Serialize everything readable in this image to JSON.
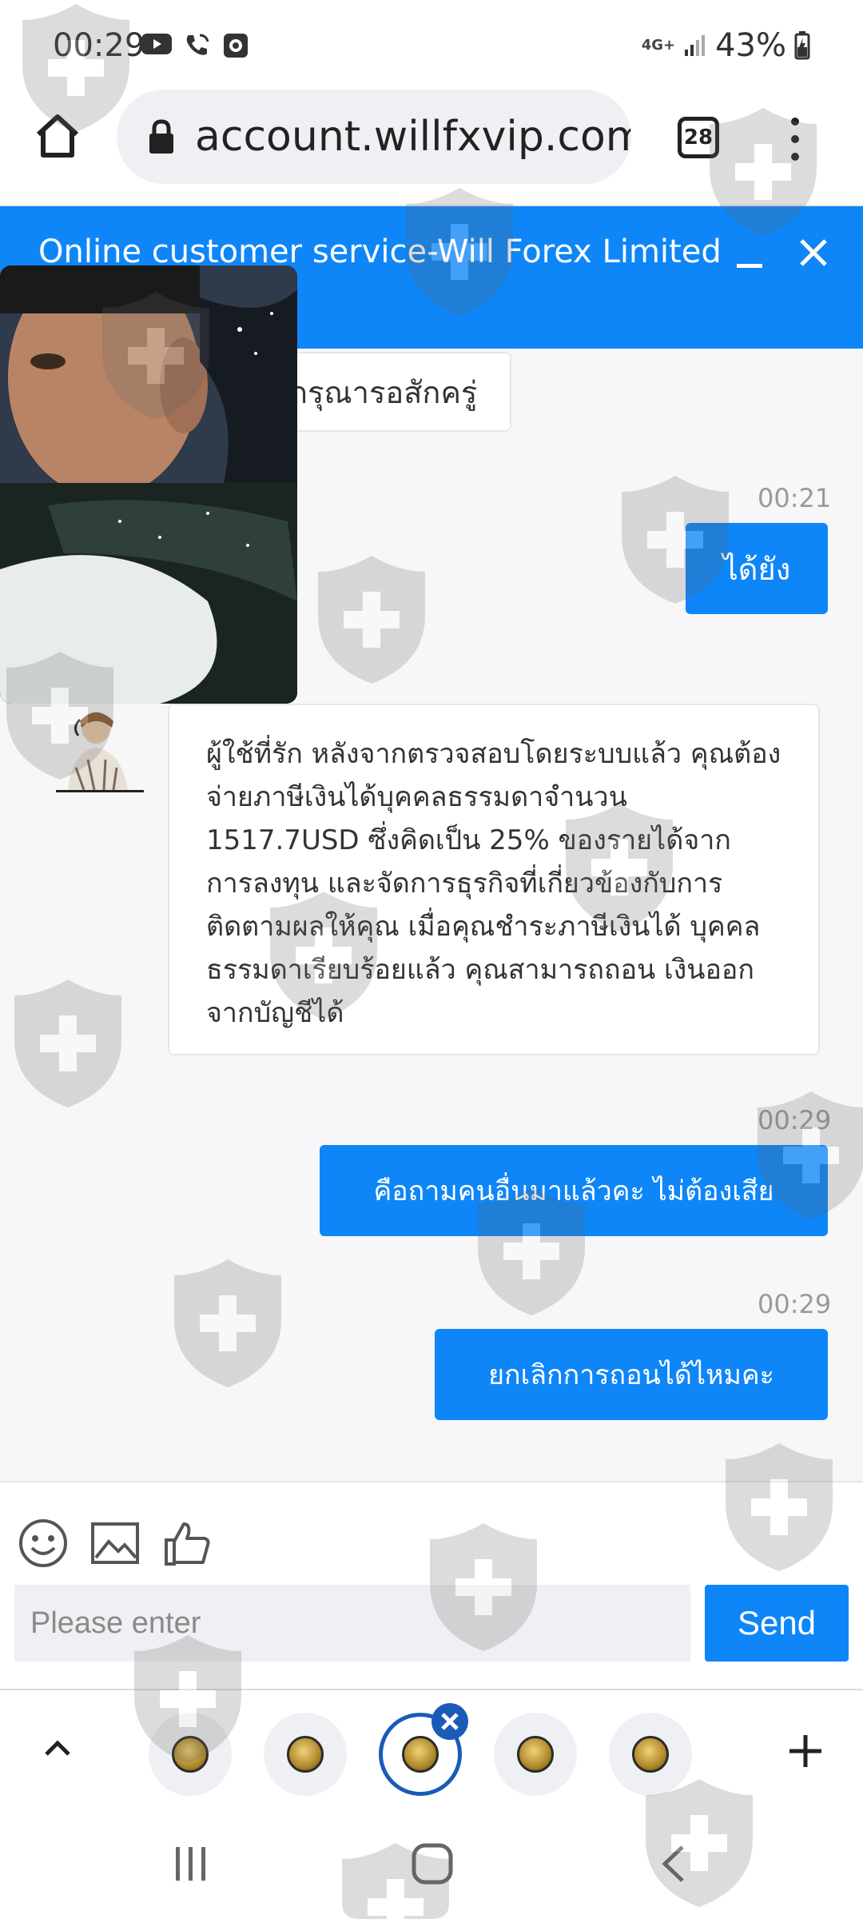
{
  "status_bar": {
    "time": "00:29",
    "network": "4G+",
    "battery": "43%",
    "icons": [
      "youtube-icon",
      "wifi-call-icon",
      "camera-app-icon",
      "signal-icon",
      "battery-icon"
    ]
  },
  "browser": {
    "url": "account.willfxvip.com",
    "tab_count": "28",
    "icons": [
      "home-icon",
      "lock-icon",
      "menu-dots-icon"
    ]
  },
  "chat": {
    "header_title": "Online customer service-Will Forex Limited",
    "header_color": "#0e86f8",
    "messages": [
      {
        "side": "in",
        "text": "กรุณารอสักครู่"
      },
      {
        "side": "out",
        "time": "00:21",
        "text": "ได้ยัง"
      },
      {
        "side": "in",
        "text": "ผู้ใช้ที่รัก หลังจากตรวจสอบโดยระบบแล้ว คุณต้องจ่ายภาษีเงินได้บุคคลธรรมดาจำนวน 1517.7USD ซึ่งคิดเป็น 25% ของรายได้จาก การลงทุน และจัดการธุรกิจที่เกี่ยวข้องกับการ ติดตามผลให้คุณ เมื่อคุณชำระภาษีเงินได้ บุคคลธรรมดาเรียบร้อยแล้ว คุณสามารถถอน เงินออกจากบัญชีได้"
      },
      {
        "side": "out",
        "time": "00:29",
        "text": "คือถามคนอื่นมาแล้วคะ ไม่ต้องเสีย"
      },
      {
        "side": "out",
        "time": "00:29",
        "text": "ยกเลิกการถอนได้ไหมคะ"
      }
    ]
  },
  "composer": {
    "placeholder": "Please enter",
    "send_label": "Send",
    "tools": [
      "emoji-icon",
      "image-icon",
      "thumbs-up-icon"
    ]
  },
  "tab_switcher": {
    "tab_count_shown": 5,
    "active_index": 2
  },
  "nav": {
    "icons": [
      "recents-icon",
      "home-nav-icon",
      "back-icon"
    ]
  }
}
